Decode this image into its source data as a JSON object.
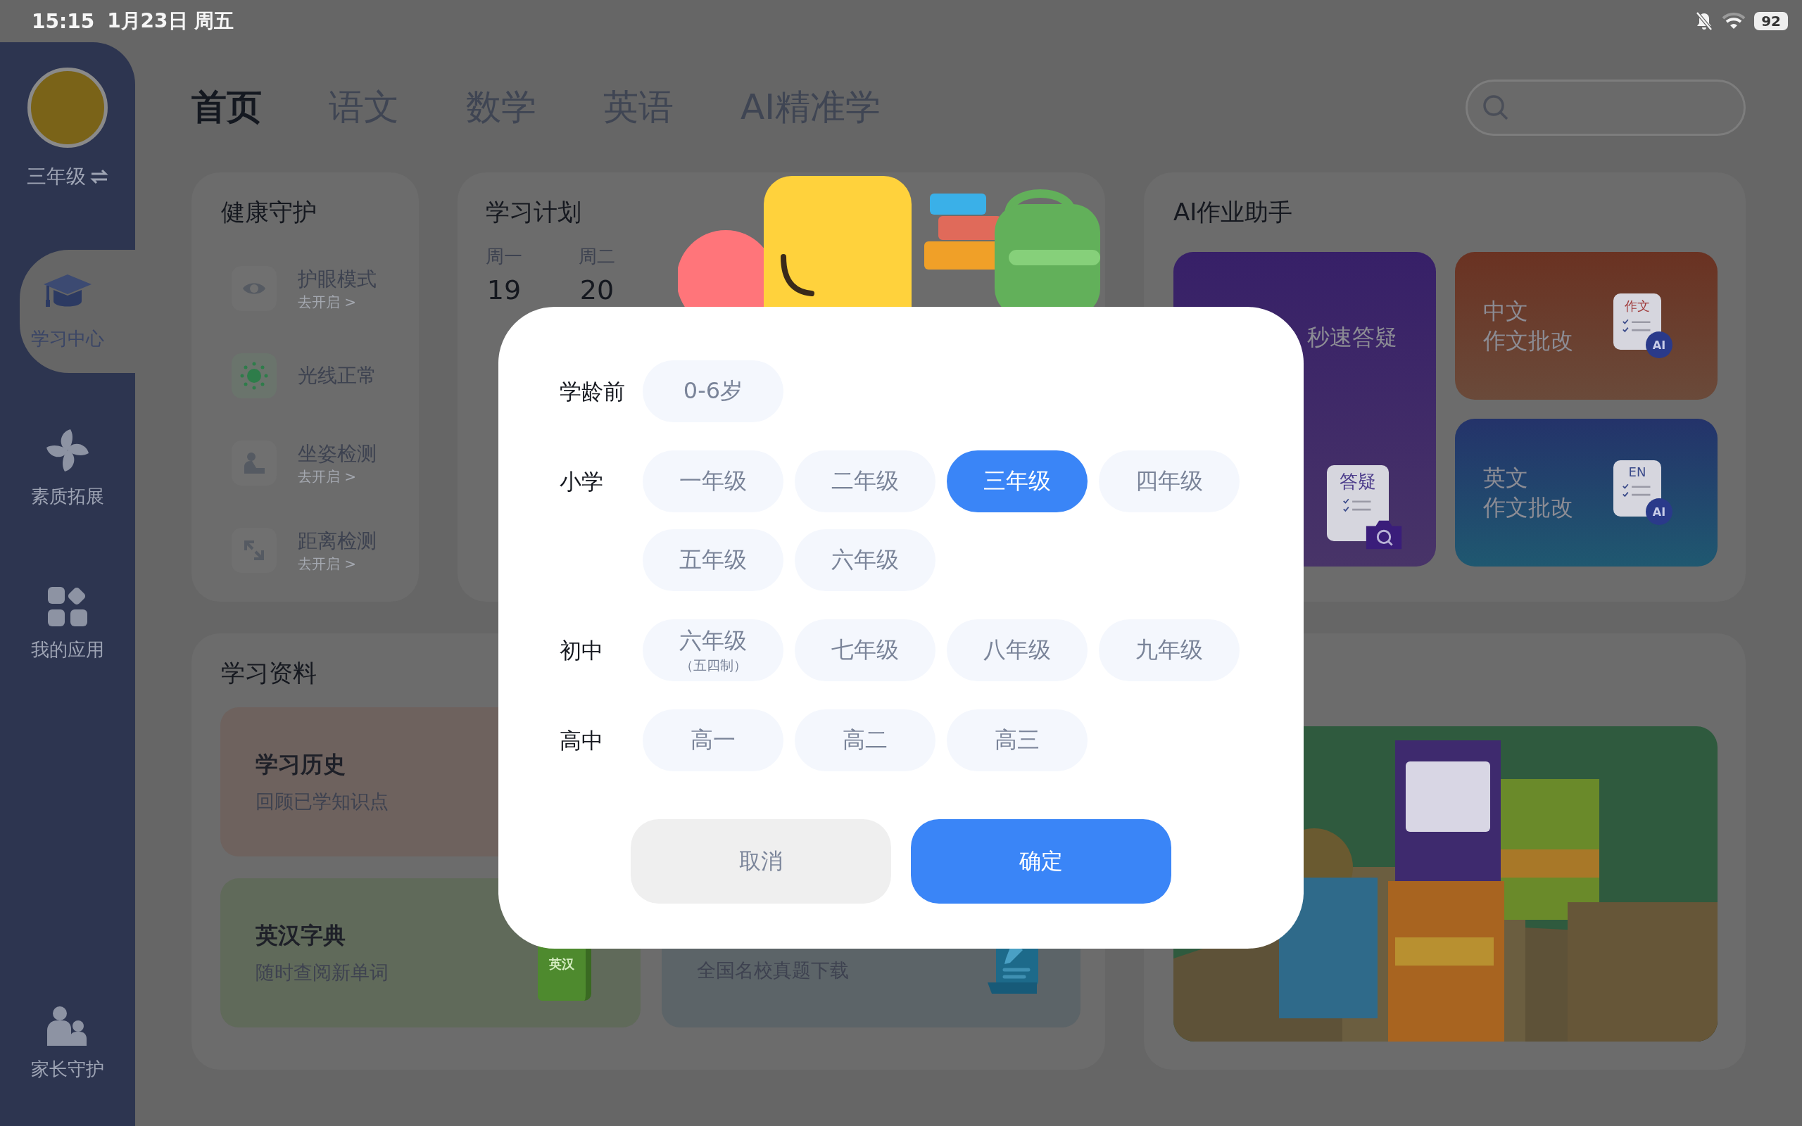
{
  "status_bar": {
    "time": "15:15",
    "date": "1月23日 周五",
    "battery": "92"
  },
  "sidebar": {
    "grade": "三年级",
    "items": [
      {
        "kind": "study",
        "label": "学习中心",
        "selected": true
      },
      {
        "kind": "quality",
        "label": "素质拓展",
        "selected": false
      },
      {
        "kind": "apps",
        "label": "我的应用",
        "selected": false
      },
      {
        "kind": "parent",
        "label": "家长守护",
        "selected": false
      }
    ]
  },
  "tabs": [
    {
      "label": "首页",
      "selected": true
    },
    {
      "label": "语文",
      "selected": false
    },
    {
      "label": "数学",
      "selected": false
    },
    {
      "label": "英语",
      "selected": false
    },
    {
      "label": "AI精准学",
      "selected": false
    }
  ],
  "health": {
    "title": "健康守护",
    "items": [
      {
        "kind": "eye",
        "title": "护眼模式",
        "action": "去开启 >",
        "active": false
      },
      {
        "kind": "light",
        "title": "光线正常",
        "active": true
      },
      {
        "kind": "posture",
        "title": "坐姿检测",
        "action": "去开启 >",
        "active": false
      },
      {
        "kind": "distance",
        "title": "距离检测",
        "action": "去开启 >",
        "active": false
      }
    ]
  },
  "plan": {
    "title": "学习计划",
    "days": [
      {
        "weekday": "周一",
        "date": "19"
      },
      {
        "weekday": "周二",
        "date": "20"
      }
    ]
  },
  "ai_helper": {
    "title": "AI作业助手",
    "cards": [
      {
        "kind": "homework",
        "lines": [
          "秒速答疑"
        ],
        "icon_text": "答疑"
      },
      {
        "kind": "chinese",
        "lines": [
          "中文",
          "作文批改"
        ],
        "icon_text": "作文",
        "badge": "AI"
      },
      {
        "kind": "english",
        "lines": [
          "英文",
          "作文批改"
        ],
        "icon_text": "EN",
        "badge": "AI"
      }
    ]
  },
  "materials": {
    "title": "学习资料",
    "cards": [
      {
        "kind": "history",
        "title": "学习历史",
        "subtitle": "回顾已学知识点"
      },
      {
        "kind": "dictionary",
        "title": "英汉字典",
        "subtitle": "随时查阅新单词",
        "icon_text": "英汉"
      },
      {
        "kind": "exam",
        "subtitle": "全国名校真题下载"
      }
    ]
  },
  "modal": {
    "groups": [
      {
        "label": "学龄前",
        "options": [
          {
            "label": "0-6岁",
            "selected": false
          }
        ]
      },
      {
        "label": "小学",
        "options": [
          {
            "label": "一年级",
            "selected": false
          },
          {
            "label": "二年级",
            "selected": false
          },
          {
            "label": "三年级",
            "selected": true
          },
          {
            "label": "四年级",
            "selected": false
          },
          {
            "label": "五年级",
            "selected": false
          },
          {
            "label": "六年级",
            "selected": false
          }
        ]
      },
      {
        "label": "初中",
        "options": [
          {
            "label": "六年级",
            "note": "（五四制）",
            "selected": false
          },
          {
            "label": "七年级",
            "selected": false
          },
          {
            "label": "八年级",
            "selected": false
          },
          {
            "label": "九年级",
            "selected": false
          }
        ]
      },
      {
        "label": "高中",
        "options": [
          {
            "label": "高一",
            "selected": false
          },
          {
            "label": "高二",
            "selected": false
          },
          {
            "label": "高三",
            "selected": false
          }
        ]
      }
    ],
    "buttons": [
      {
        "kind": "cancel",
        "label": "取消"
      },
      {
        "kind": "confirm",
        "label": "确定"
      }
    ]
  }
}
